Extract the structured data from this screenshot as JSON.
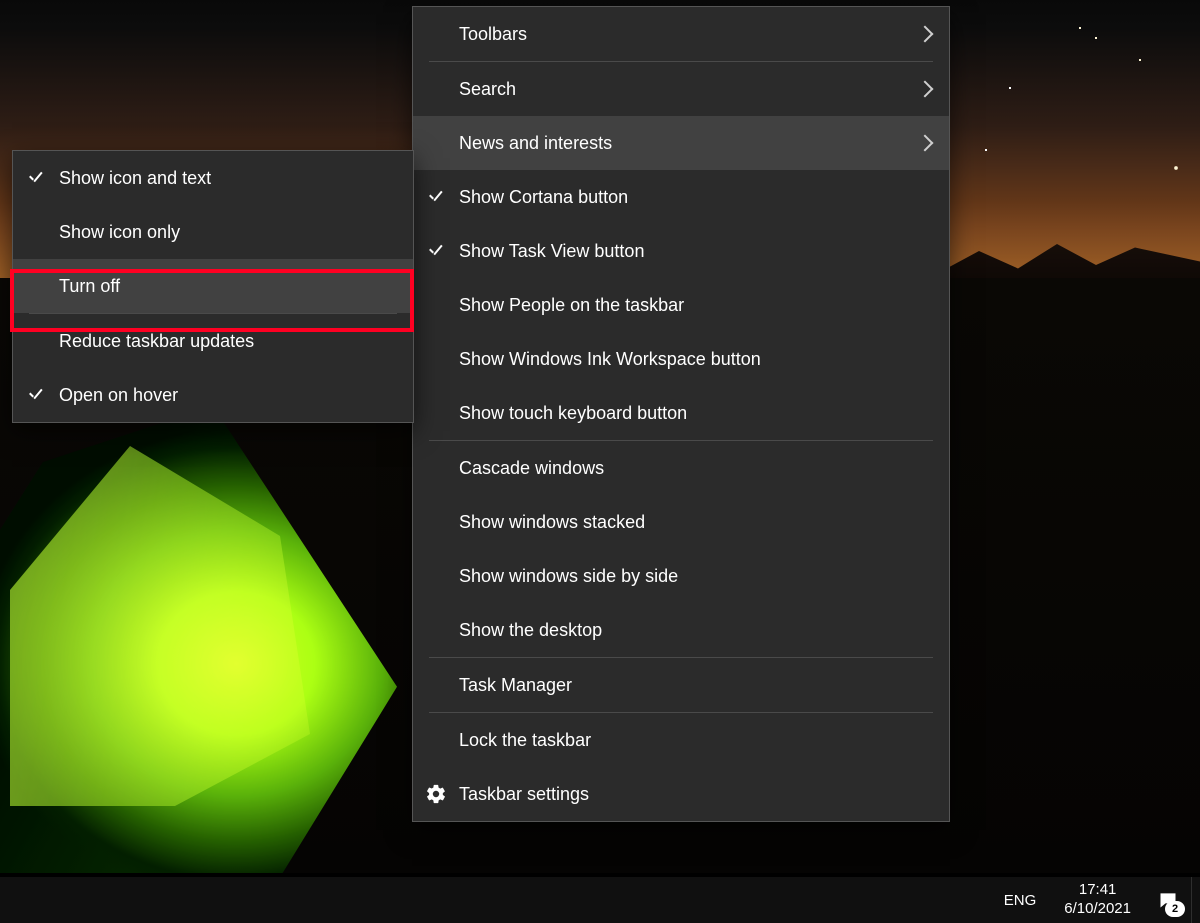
{
  "submenu": {
    "items": [
      {
        "label": "Show icon and text",
        "checked": true
      },
      {
        "label": "Show icon only",
        "checked": false
      },
      {
        "label": "Turn off",
        "checked": false,
        "highlighted": true
      }
    ],
    "items2": [
      {
        "label": "Reduce taskbar updates",
        "checked": false
      },
      {
        "label": "Open on hover",
        "checked": true
      }
    ]
  },
  "mainmenu": {
    "group1": [
      {
        "label": "Toolbars",
        "arrow": true
      },
      {
        "label": "Search",
        "arrow": true
      },
      {
        "label": "News and interests",
        "arrow": true,
        "hover": true
      },
      {
        "label": "Show Cortana button",
        "checked": true
      },
      {
        "label": "Show Task View button",
        "checked": true
      },
      {
        "label": "Show People on the taskbar"
      },
      {
        "label": "Show Windows Ink Workspace button"
      },
      {
        "label": "Show touch keyboard button"
      }
    ],
    "group2": [
      {
        "label": "Cascade windows"
      },
      {
        "label": "Show windows stacked"
      },
      {
        "label": "Show windows side by side"
      },
      {
        "label": "Show the desktop"
      }
    ],
    "group3": [
      {
        "label": "Task Manager"
      }
    ],
    "group4": [
      {
        "label": "Lock the taskbar"
      },
      {
        "label": "Taskbar settings",
        "icon": "gear"
      }
    ]
  },
  "taskbar": {
    "lang": "ENG",
    "time": "17:41",
    "date": "6/10/2021",
    "notifications": "2"
  }
}
